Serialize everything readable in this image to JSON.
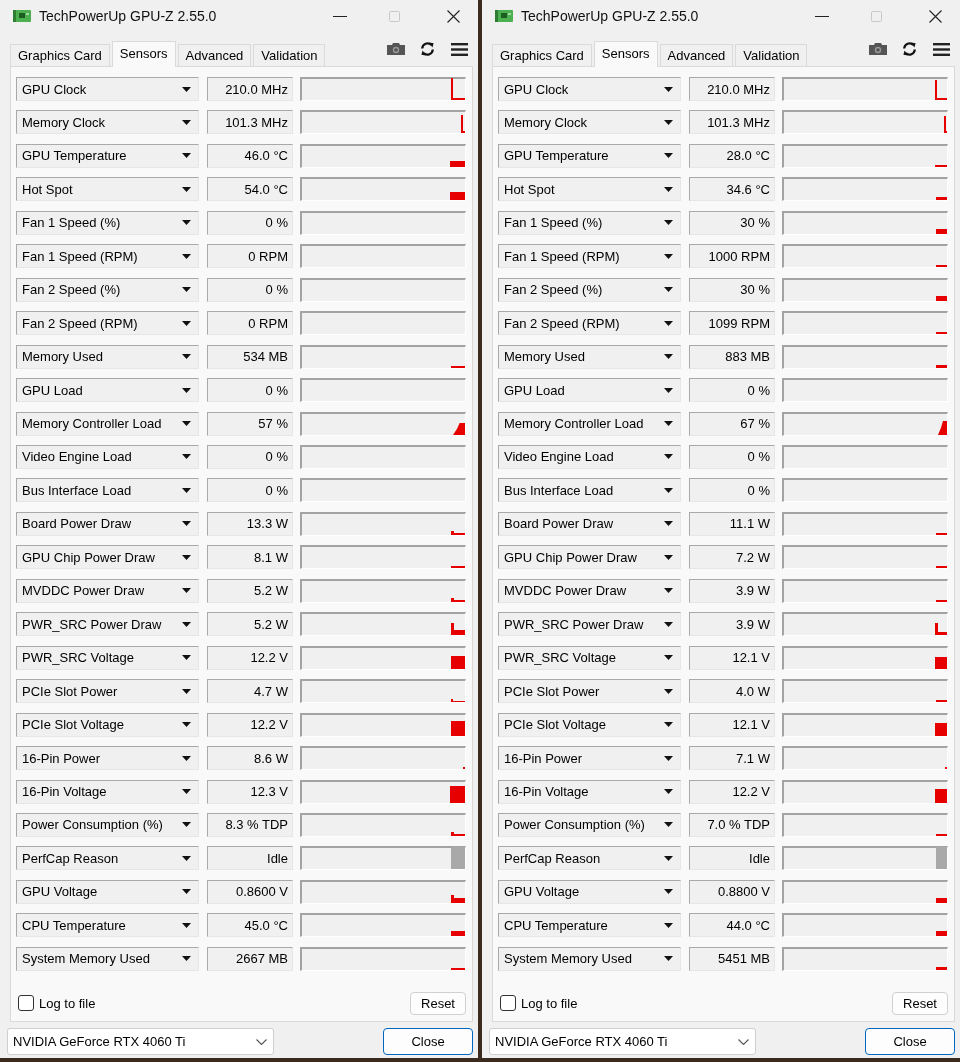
{
  "windows": [
    {
      "title": "TechPowerUp GPU-Z 2.55.0",
      "maximize": {
        "disabled": true
      },
      "tabs": [
        {
          "label": "Graphics Card",
          "selected": false
        },
        {
          "label": "Sensors",
          "selected": true
        },
        {
          "label": "Advanced",
          "selected": false
        },
        {
          "label": "Validation",
          "selected": false
        }
      ],
      "sensors": [
        {
          "name": "GPU Clock",
          "value": "210.0 MHz"
        },
        {
          "name": "Memory Clock",
          "value": "101.3 MHz"
        },
        {
          "name": "GPU Temperature",
          "value": "46.0 °C"
        },
        {
          "name": "Hot Spot",
          "value": "54.0 °C"
        },
        {
          "name": "Fan 1 Speed (%)",
          "value": "0 %"
        },
        {
          "name": "Fan 1 Speed (RPM)",
          "value": "0 RPM"
        },
        {
          "name": "Fan 2 Speed (%)",
          "value": "0 %"
        },
        {
          "name": "Fan 2 Speed (RPM)",
          "value": "0 RPM"
        },
        {
          "name": "Memory Used",
          "value": "534 MB"
        },
        {
          "name": "GPU Load",
          "value": "0 %"
        },
        {
          "name": "Memory Controller Load",
          "value": "57 %"
        },
        {
          "name": "Video Engine Load",
          "value": "0 %"
        },
        {
          "name": "Bus Interface Load",
          "value": "0 %"
        },
        {
          "name": "Board Power Draw",
          "value": "13.3 W"
        },
        {
          "name": "GPU Chip Power Draw",
          "value": "8.1 W"
        },
        {
          "name": "MVDDC Power Draw",
          "value": "5.2 W"
        },
        {
          "name": "PWR_SRC Power Draw",
          "value": "5.2 W"
        },
        {
          "name": "PWR_SRC Voltage",
          "value": "12.2 V"
        },
        {
          "name": "PCIe Slot Power",
          "value": "4.7 W"
        },
        {
          "name": "PCIe Slot Voltage",
          "value": "12.2 V"
        },
        {
          "name": "16-Pin Power",
          "value": "8.6 W"
        },
        {
          "name": "16-Pin Voltage",
          "value": "12.3 V"
        },
        {
          "name": "Power Consumption (%)",
          "value": "8.3 % TDP"
        },
        {
          "name": "PerfCap Reason",
          "value": "Idle"
        },
        {
          "name": "GPU Voltage",
          "value": "0.8600 V"
        },
        {
          "name": "CPU Temperature",
          "value": "45.0 °C"
        },
        {
          "name": "System Memory Used",
          "value": "2667 MB"
        }
      ],
      "log_to_file": {
        "label": "Log to file",
        "checked": false
      },
      "reset_button": "Reset",
      "gpu_select": {
        "value": "NVIDIA GeForce RTX 4060 Ti"
      },
      "close_button": "Close"
    },
    {
      "title": "TechPowerUp GPU-Z 2.55.0",
      "maximize": {
        "disabled": true
      },
      "tabs": [
        {
          "label": "Graphics Card",
          "selected": false
        },
        {
          "label": "Sensors",
          "selected": true
        },
        {
          "label": "Advanced",
          "selected": false
        },
        {
          "label": "Validation",
          "selected": false
        }
      ],
      "sensors": [
        {
          "name": "GPU Clock",
          "value": "210.0 MHz"
        },
        {
          "name": "Memory Clock",
          "value": "101.3 MHz"
        },
        {
          "name": "GPU Temperature",
          "value": "28.0 °C"
        },
        {
          "name": "Hot Spot",
          "value": "34.6 °C"
        },
        {
          "name": "Fan 1 Speed (%)",
          "value": "30 %"
        },
        {
          "name": "Fan 1 Speed (RPM)",
          "value": "1000 RPM"
        },
        {
          "name": "Fan 2 Speed (%)",
          "value": "30 %"
        },
        {
          "name": "Fan 2 Speed (RPM)",
          "value": "1099 RPM"
        },
        {
          "name": "Memory Used",
          "value": "883 MB"
        },
        {
          "name": "GPU Load",
          "value": "0 %"
        },
        {
          "name": "Memory Controller Load",
          "value": "67 %"
        },
        {
          "name": "Video Engine Load",
          "value": "0 %"
        },
        {
          "name": "Bus Interface Load",
          "value": "0 %"
        },
        {
          "name": "Board Power Draw",
          "value": "11.1 W"
        },
        {
          "name": "GPU Chip Power Draw",
          "value": "7.2 W"
        },
        {
          "name": "MVDDC Power Draw",
          "value": "3.9 W"
        },
        {
          "name": "PWR_SRC Power Draw",
          "value": "3.9 W"
        },
        {
          "name": "PWR_SRC Voltage",
          "value": "12.1 V"
        },
        {
          "name": "PCIe Slot Power",
          "value": "4.0 W"
        },
        {
          "name": "PCIe Slot Voltage",
          "value": "12.1 V"
        },
        {
          "name": "16-Pin Power",
          "value": "7.1 W"
        },
        {
          "name": "16-Pin Voltage",
          "value": "12.2 V"
        },
        {
          "name": "Power Consumption (%)",
          "value": "7.0 % TDP"
        },
        {
          "name": "PerfCap Reason",
          "value": "Idle"
        },
        {
          "name": "GPU Voltage",
          "value": "0.8800 V"
        },
        {
          "name": "CPU Temperature",
          "value": "44.0 °C"
        },
        {
          "name": "System Memory Used",
          "value": "5451 MB"
        }
      ],
      "log_to_file": {
        "label": "Log to file",
        "checked": false
      },
      "reset_button": "Reset",
      "gpu_select": {
        "value": "NVIDIA GeForce RTX 4060 Ti"
      },
      "close_button": "Close"
    }
  ]
}
